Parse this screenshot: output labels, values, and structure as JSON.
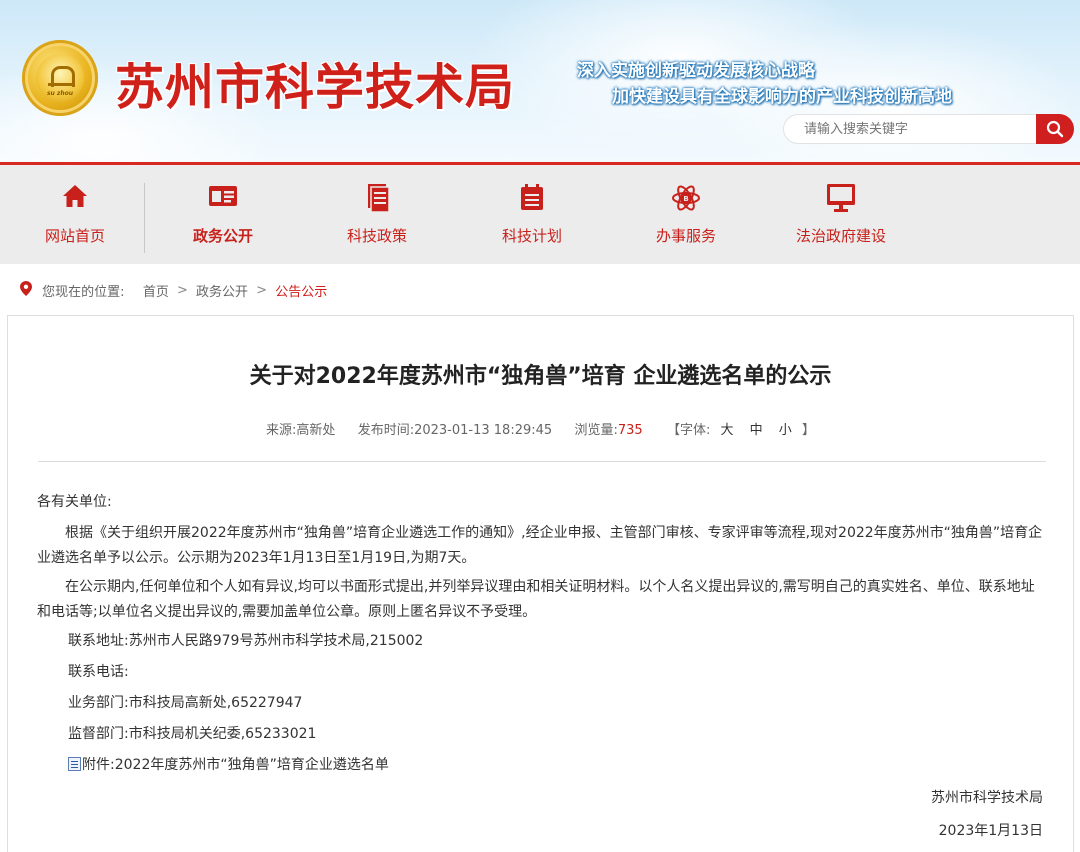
{
  "header": {
    "site_title": "苏州市科学技术局",
    "emblem_text": "su zhou",
    "slogan_line1": "深入实施创新驱动发展核心战略",
    "slogan_line2": "加快建设具有全球影响力的产业科技创新高地",
    "search_placeholder": "请输入搜索关键字",
    "accent_color": "#d0201a"
  },
  "nav": {
    "items": [
      {
        "label": "网站首页",
        "icon": "home-icon"
      },
      {
        "label": "政务公开",
        "icon": "id-card-icon",
        "active": true
      },
      {
        "label": "科技政策",
        "icon": "document-stack-icon"
      },
      {
        "label": "科技计划",
        "icon": "calendar-icon"
      },
      {
        "label": "办事服务",
        "icon": "atom-icon"
      },
      {
        "label": "法治政府建设",
        "icon": "monitor-icon"
      }
    ]
  },
  "breadcrumb": {
    "prefix": "您现在的位置:",
    "items": [
      "首页",
      "政务公开",
      "公告公示"
    ],
    "separator": ">"
  },
  "article": {
    "title": "关于对2022年度苏州市“独角兽”培育 企业遴选名单的公示",
    "meta": {
      "source_label": "来源:",
      "source": "高新处",
      "time_label": "发布时间:",
      "time": "2023-01-13 18:29:45",
      "views_label": "浏览量:",
      "views": "735",
      "font_label": "【字体:",
      "font_large": "大",
      "font_medium": "中",
      "font_small": "小",
      "font_close": "】"
    },
    "greeting": "各有关单位:",
    "para1": "根据《关于组织开展2022年度苏州市“独角兽”培育企业遴选工作的通知》,经企业申报、主管部门审核、专家评审等流程,现对2022年度苏州市“独角兽”培育企业遴选名单予以公示。公示期为2023年1月13日至1月19日,为期7天。",
    "para2": "在公示期内,任何单位和个人如有异议,均可以书面形式提出,并列举异议理由和相关证明材料。以个人名义提出异议的,需写明自己的真实姓名、单位、联系地址和电话等;以单位名义提出异议的,需要加盖单位公章。原则上匿名异议不予受理。",
    "contact_address": "联系地址:苏州市人民路979号苏州市科学技术局,215002",
    "contact_phone_label": "联系电话:",
    "business_dept": "业务部门:市科技局高新处,65227947",
    "supervision_dept": "监督部门:市科技局机关纪委,65233021",
    "attachment": "附件:2022年度苏州市“独角兽”培育企业遴选名单",
    "signature": "苏州市科学技术局",
    "date": "2023年1月13日"
  }
}
